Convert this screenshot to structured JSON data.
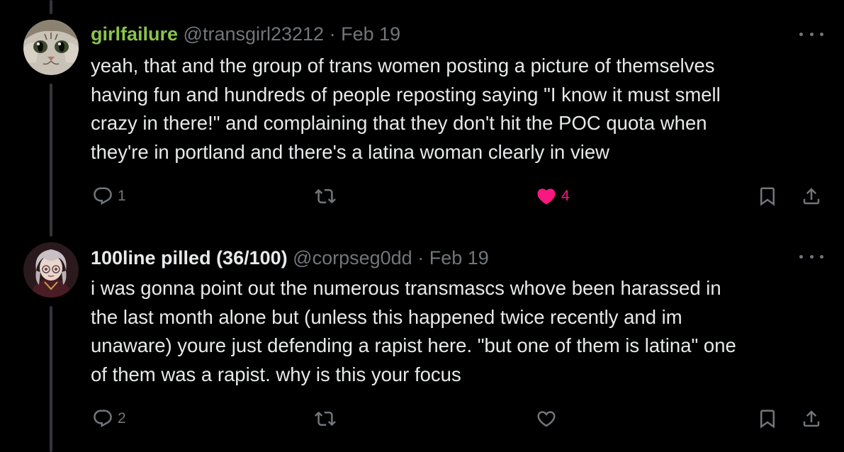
{
  "colors": {
    "background": "#000000",
    "text": "#e7e9ea",
    "muted": "#71767b",
    "first_display_name": "#8bc34a",
    "like_active": "#f91880",
    "thread_line": "#333639"
  },
  "posts": [
    {
      "display_name": "girlfailure",
      "handle": "@transgirl23212",
      "separator": "·",
      "date": "Feb 19",
      "text": "yeah, that and the group of trans women posting a picture of themselves\nhaving fun and hundreds of people reposting saying \"I know it must smell\ncrazy in there!\" and complaining that they don't hit the POC quota when\nthey're in portland and there's a latina woman clearly in view",
      "reply_count": "1",
      "like_count": "4",
      "liked": true,
      "avatar_icon": "cat-avatar"
    },
    {
      "display_name": "100line pilled (36/100)",
      "handle": "@corpseg0dd",
      "separator": "·",
      "date": "Feb 19",
      "text": "i was gonna point out the numerous transmascs whove been harassed in\nthe last month alone but (unless this happened twice recently and im\nunaware) youre just defending a rapist here. \"but one of them is latina\" one\nof them was a rapist. why is this your focus",
      "reply_count": "2",
      "like_count": "",
      "liked": false,
      "avatar_icon": "anime-character-avatar"
    }
  ]
}
